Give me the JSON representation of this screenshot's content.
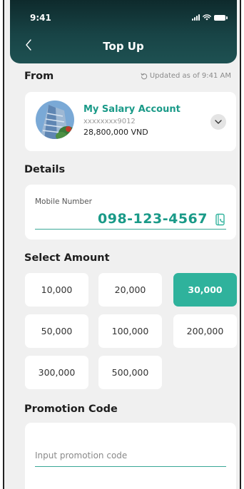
{
  "status_bar": {
    "time": "9:41"
  },
  "header": {
    "title": "Top Up"
  },
  "from": {
    "label": "From",
    "updated_text": "Updated as of 9:41 AM",
    "account": {
      "name": "My Salary Account",
      "number": "xxxxxxxx9012",
      "balance": "28,800,000 VND"
    }
  },
  "details": {
    "label": "Details",
    "mobile_label": "Mobile Number",
    "mobile_value": "098-123-4567"
  },
  "amount": {
    "label": "Select Amount",
    "options": [
      "10,000",
      "20,000",
      "30,000",
      "50,000",
      "100,000",
      "200,000",
      "300,000",
      "500,000"
    ],
    "selected": "30,000"
  },
  "promotion": {
    "label": "Promotion Code",
    "placeholder": "Input promotion code"
  },
  "colors": {
    "accent": "#2fb29c",
    "header_dark": "#0e2a2c",
    "background": "#f0f0f0"
  }
}
